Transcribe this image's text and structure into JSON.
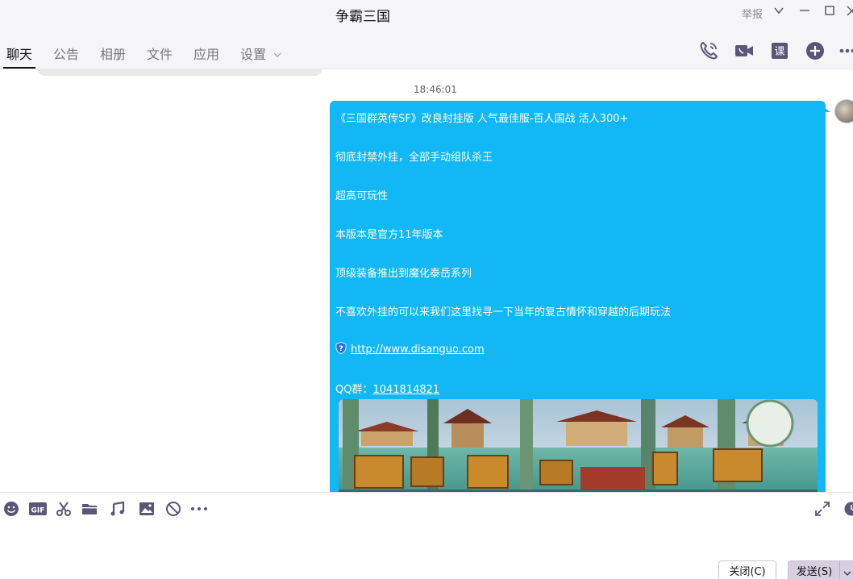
{
  "window": {
    "title": "争霸三国",
    "report_label": "举报"
  },
  "tabs": [
    {
      "label": "聊天"
    },
    {
      "label": "公告"
    },
    {
      "label": "相册"
    },
    {
      "label": "文件"
    },
    {
      "label": "应用"
    },
    {
      "label": "设置"
    }
  ],
  "toolbar_right_icons": [
    "phone-icon",
    "video-call-icon",
    "course-icon",
    "add-icon",
    "more-icon"
  ],
  "toolbar_course_glyph": "课",
  "chat": {
    "timestamp": "18:46:01",
    "message": {
      "lines": [
        "《三国群英传SF》改良封挂版 人气最佳服-百人国战 活人300+",
        "彻底封禁外挂，全部手动组队杀王",
        "超高可玩性",
        "本版本是官方11年版本",
        "顶级装备推出到魔化泰岳系列",
        "不喜欢外挂的可以来我们这里找寻一下当年的复古情怀和穿越的后期玩法"
      ],
      "link": "http://www.disanguo.com",
      "qq_label": "QQ群：",
      "qq_number": "1041814821"
    }
  },
  "input_toolbar_icons": [
    "emoji-icon",
    "gif-icon",
    "scissors-icon",
    "folder-icon",
    "music-icon",
    "image-icon",
    "block-icon",
    "more-icon"
  ],
  "gif_label": "GIF",
  "buttons": {
    "close": "关闭(C)",
    "send": "发送(S)"
  },
  "colors": {
    "bubble": "#12b7f5",
    "titlebar": "#f5f5f7",
    "send_button": "#d7cfe0"
  }
}
